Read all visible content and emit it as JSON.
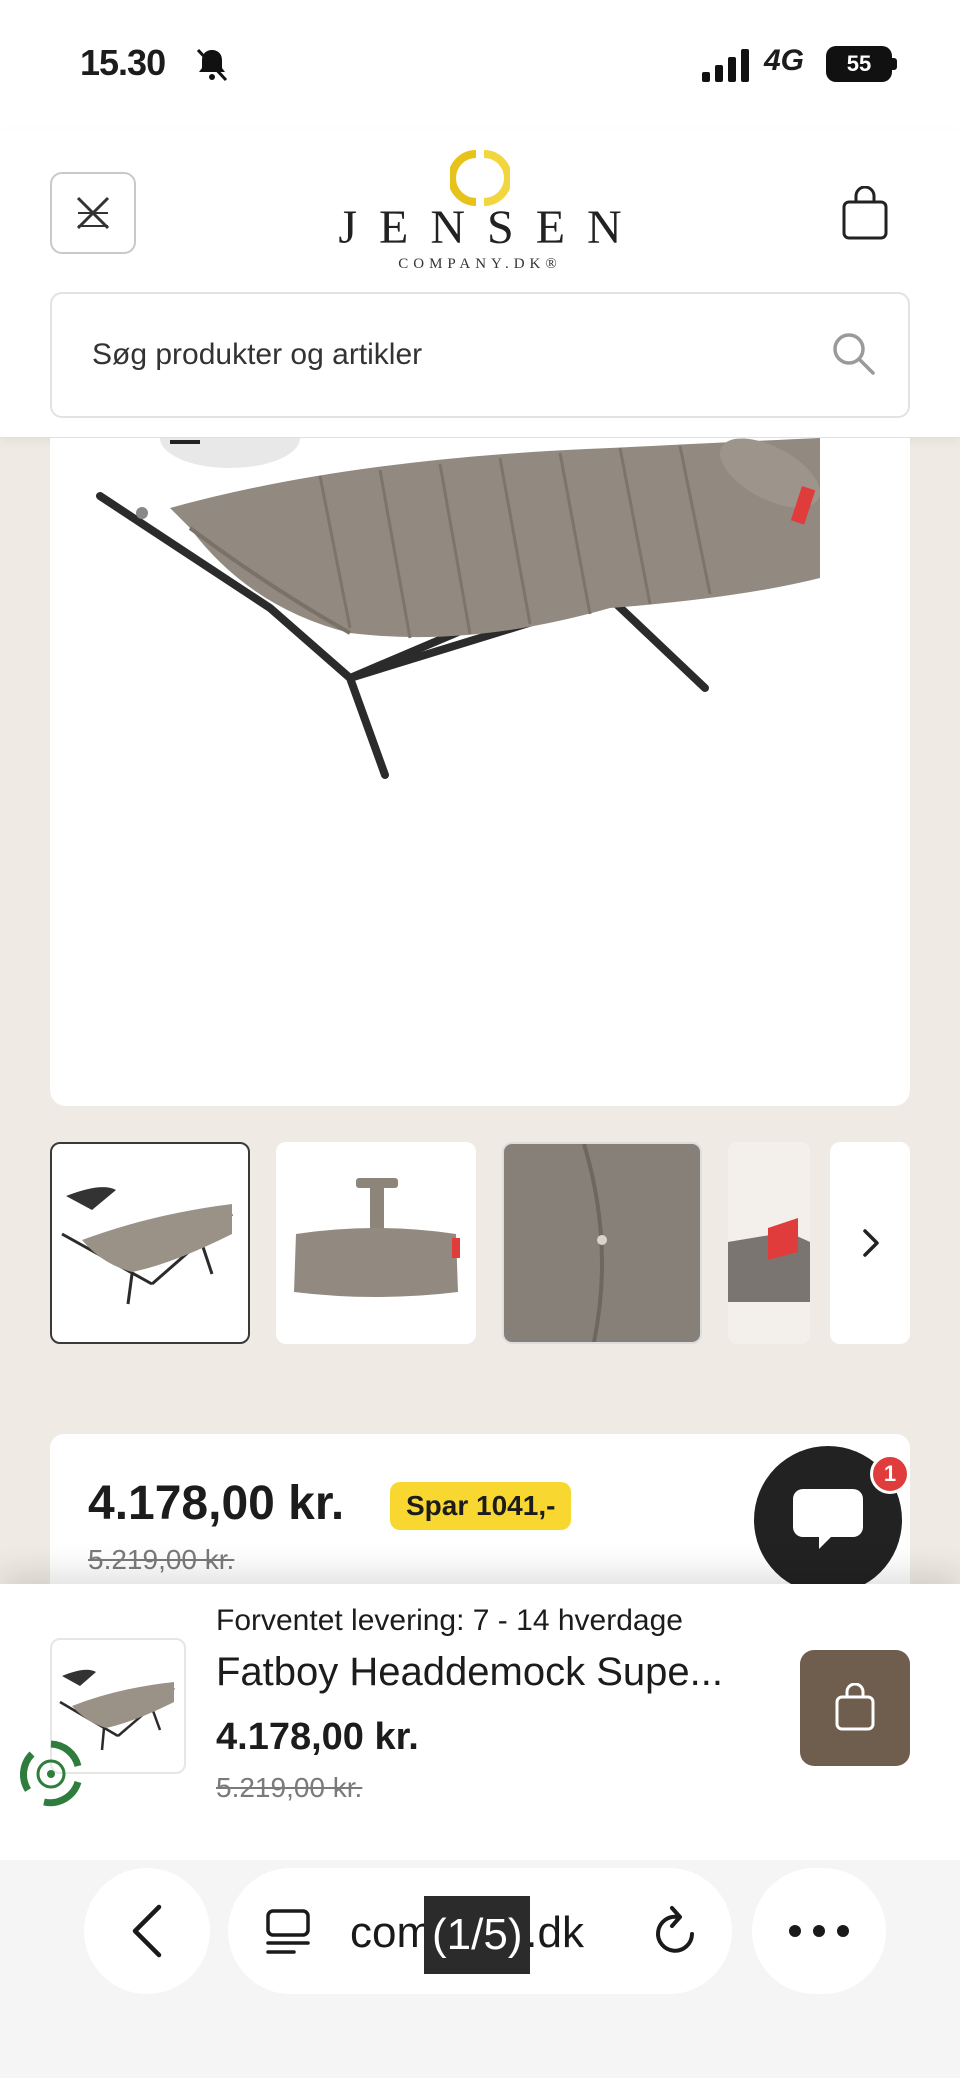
{
  "status_bar": {
    "time": "15.30",
    "network": "4G",
    "battery": "55",
    "icons": [
      "bell-slash-icon",
      "signal-icon"
    ]
  },
  "header": {
    "logo_text": "JENSEN",
    "logo_tagline": "COMPANY.DK®",
    "menu_icon": "close-icon",
    "cart_icon": "shopping-bag-icon"
  },
  "search": {
    "placeholder": "Søg produkter og artikler",
    "icon": "search-icon"
  },
  "gallery": {
    "thumbnails": [
      "hammock-thumb",
      "pillow-thumb",
      "fabric-detail-thumb",
      "brand-label-thumb"
    ],
    "next_icon": "chevron-right-icon"
  },
  "price": {
    "current": "4.178,00 kr.",
    "badge": "Spar 1041,-",
    "old": "5.219,00 kr.",
    "badge_color": "#f8d830"
  },
  "chat": {
    "badge_count": "1",
    "icon": "chat-bubble-icon"
  },
  "sticky": {
    "delivery": "Forventet levering: 7 - 14 hverdage",
    "title": "Fatboy Headdemock Supe...",
    "price": "4.178,00 kr.",
    "old_price": "5.219,00 kr.",
    "button_color": "#6f5e4e"
  },
  "browser": {
    "url": "company.dk",
    "page_counter": "(1/5)",
    "icons": [
      "back-icon",
      "tabs-icon",
      "reload-icon",
      "more-icon"
    ]
  }
}
